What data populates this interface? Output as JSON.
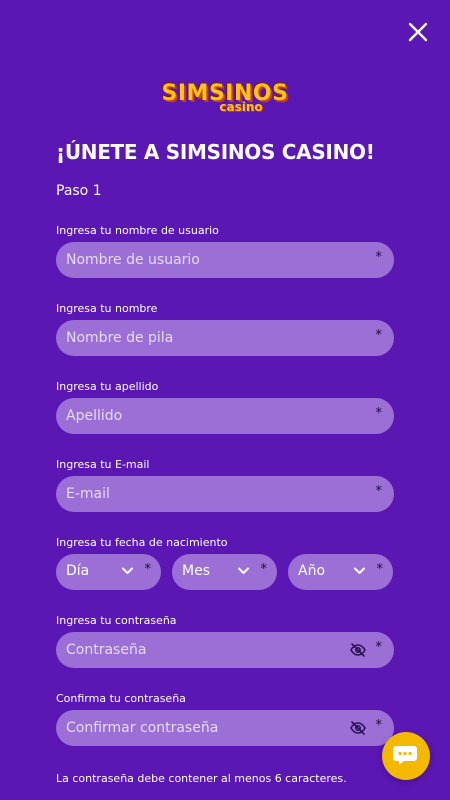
{
  "logo": {
    "main": "SIMSINOS",
    "sub": "casino"
  },
  "title": "¡ÚNETE A SIMSINOS CASINO!",
  "step": "Paso 1",
  "fields": {
    "username": {
      "label": "Ingresa tu nombre de usuario",
      "placeholder": "Nombre de usuario",
      "required": "*"
    },
    "first_name": {
      "label": "Ingresa tu nombre",
      "placeholder": "Nombre de pila",
      "required": "*"
    },
    "last_name": {
      "label": "Ingresa tu apellido",
      "placeholder": "Apellido",
      "required": "*"
    },
    "email": {
      "label": "Ingresa tu E-mail",
      "placeholder": "E-mail",
      "required": "*"
    },
    "password": {
      "label": "Ingresa tu contraseña",
      "placeholder": "Contraseña",
      "required": "*"
    },
    "confirm_password": {
      "label": "Confirma tu contraseña",
      "placeholder": "Confirmar contraseña",
      "required": "*"
    }
  },
  "birthdate": {
    "label": "Ingresa tu fecha de nacimiento",
    "day": {
      "value": "Día",
      "required": "*"
    },
    "month": {
      "value": "Mes",
      "required": "*"
    },
    "year": {
      "value": "Año",
      "required": "*"
    }
  },
  "hint": "La contraseña debe contener al menos 6 caracteres.",
  "icons": {
    "close": "close-icon",
    "eye_off": "eye-off-icon",
    "chevron": "chevron-down-icon",
    "chat": "chat-bubble-icon"
  },
  "colors": {
    "background": "#5a17b3",
    "input_bg": "#9b6fd6",
    "brand_yellow": "#ffc21a",
    "chat_button": "#f5b800"
  }
}
